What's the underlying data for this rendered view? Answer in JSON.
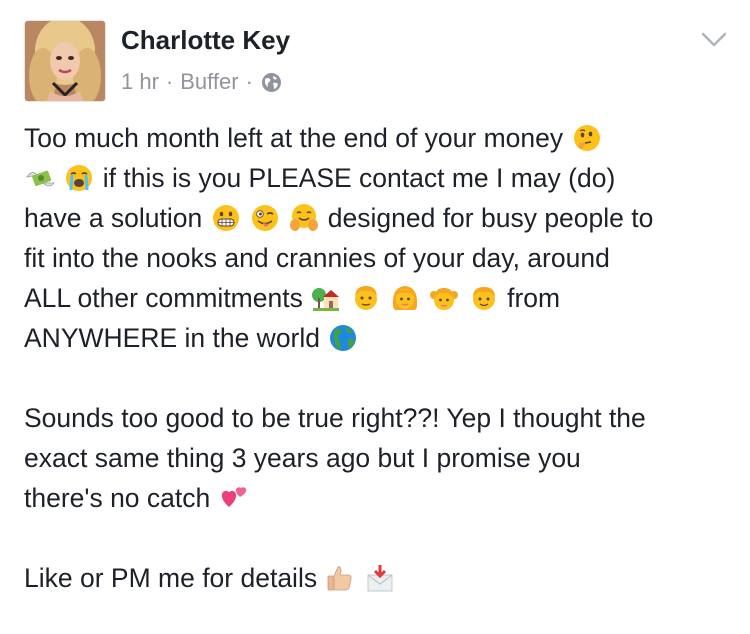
{
  "post": {
    "author": "Charlotte Key",
    "time": "1 hr",
    "separator": "·",
    "app": "Buffer",
    "privacy_icon": "globe-icon",
    "menu_icon": "chevron-down-icon"
  },
  "body": {
    "p1": {
      "l1a": "Too much month left at the end of your money",
      "l2b": " if this is you PLEASE contact me I may (do)",
      "l3a": "have a solution ",
      "l3b": " designed for busy people to",
      "l4": "fit into the nooks and crannies of your day, around",
      "l5a": "ALL other commitments ",
      "l5b": " from",
      "l6a": "ANYWHERE in the world "
    },
    "p2": {
      "l1": "Sounds too good to be true right??! Yep I thought the",
      "l2": "exact same thing 3 years ago but I promise you",
      "l3a": "there's no catch "
    },
    "p3": {
      "l1a": "Like or PM me for details "
    }
  },
  "emoji_names": [
    "thinking-face",
    "money-with-wings",
    "loudly-crying-face",
    "grimacing-face",
    "winking-tongue-face",
    "hugging-face",
    "house-with-garden",
    "man",
    "woman",
    "girl",
    "boy",
    "globe-americas",
    "two-hearts",
    "thumbs-up",
    "envelope-with-arrow"
  ]
}
